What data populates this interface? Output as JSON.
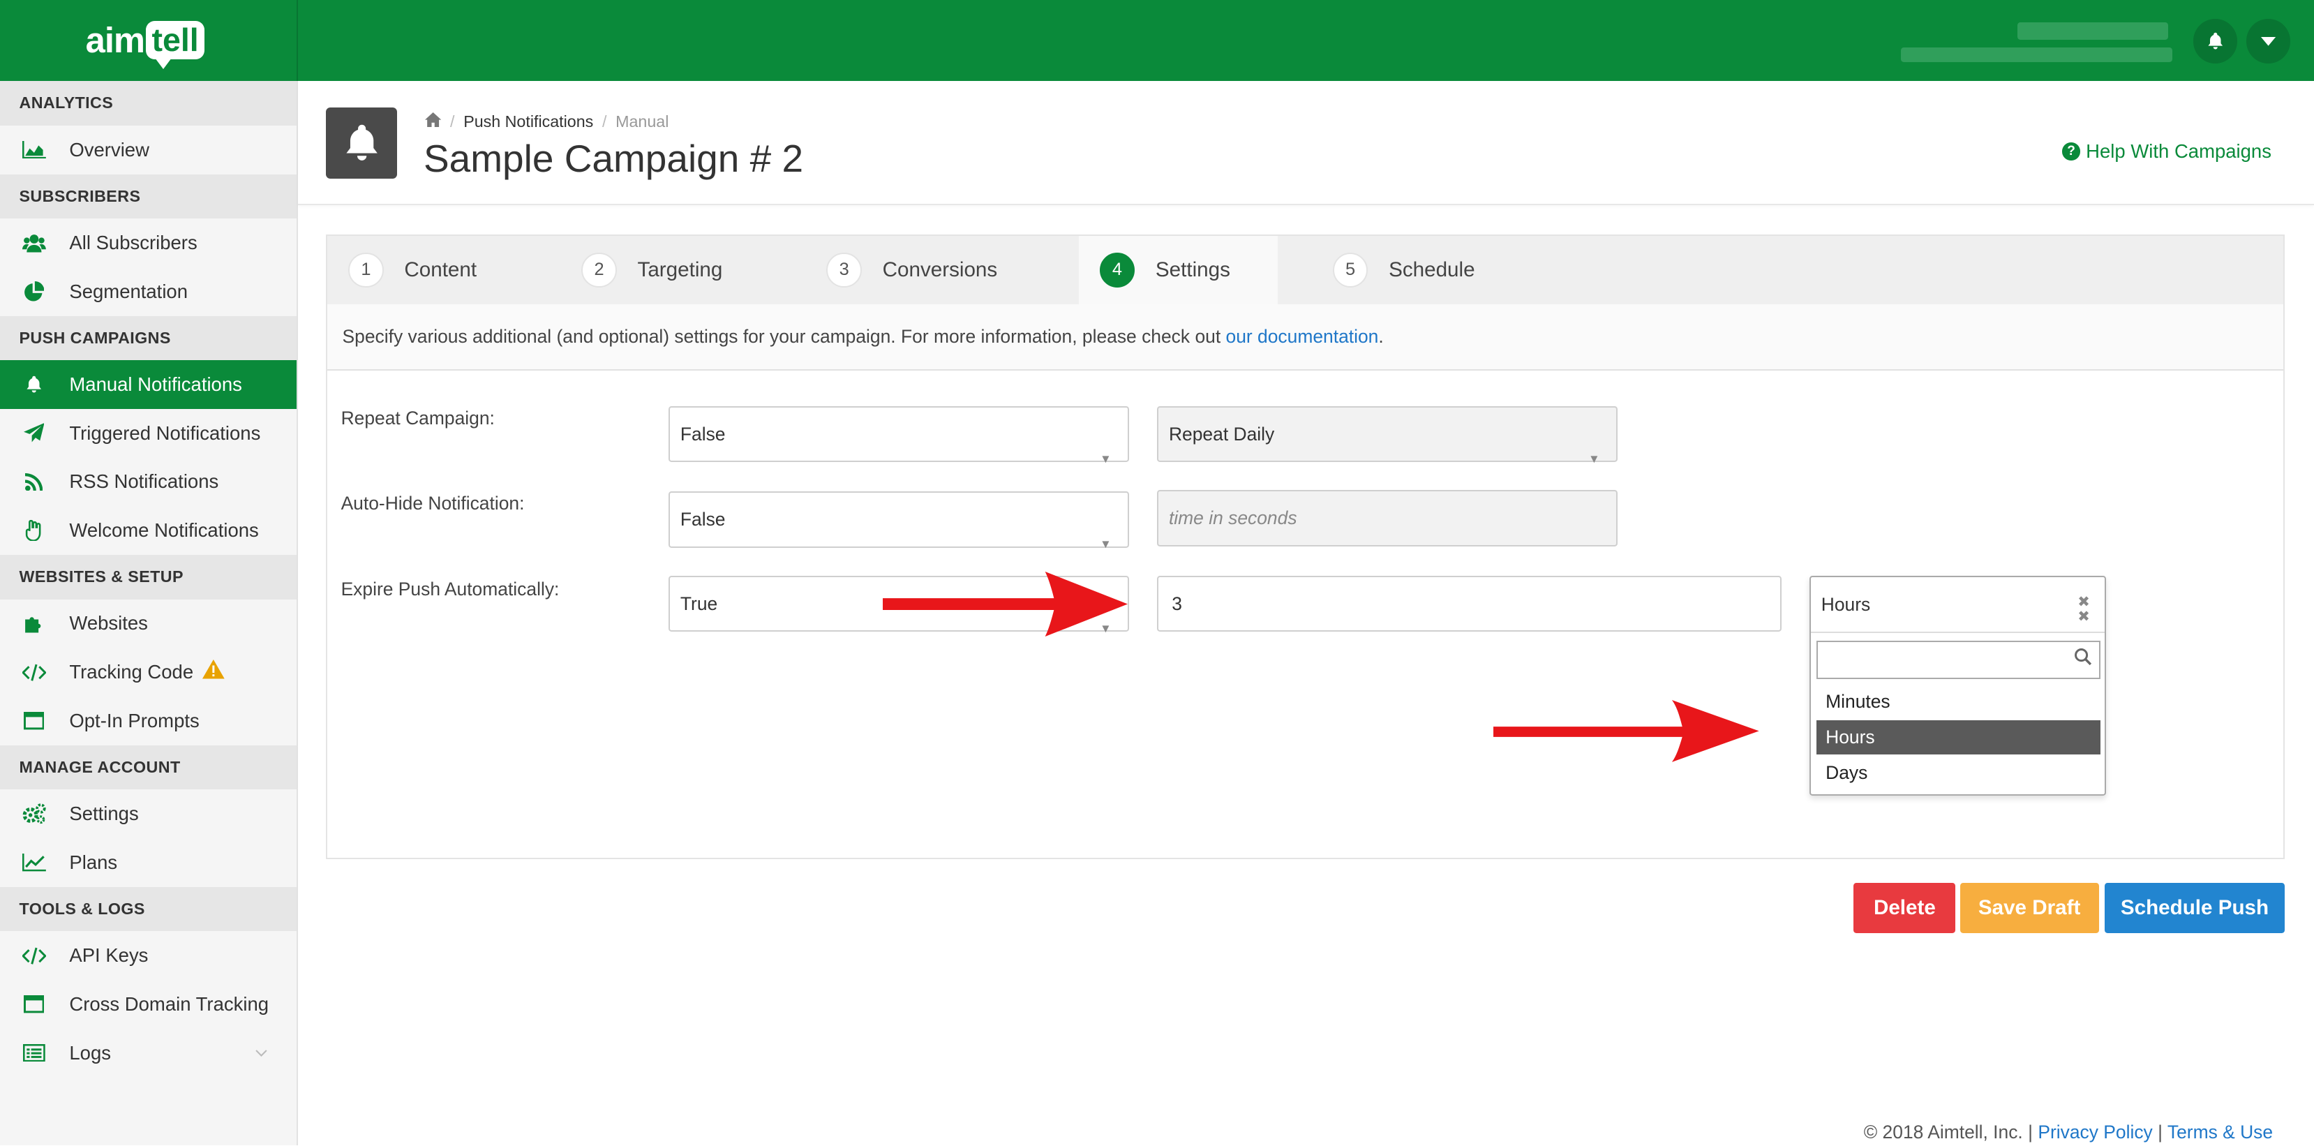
{
  "brand": {
    "logo_part1": "aim",
    "logo_part2": "tell"
  },
  "topbar": {
    "bell_icon": "bell-icon",
    "menu_icon": "chevron-down-icon"
  },
  "sidebar": {
    "sections": [
      {
        "title": "ANALYTICS",
        "items": [
          {
            "label": "Overview",
            "icon": "area-chart-icon"
          }
        ]
      },
      {
        "title": "SUBSCRIBERS",
        "items": [
          {
            "label": "All Subscribers",
            "icon": "users-icon"
          },
          {
            "label": "Segmentation",
            "icon": "pie-chart-icon"
          }
        ]
      },
      {
        "title": "PUSH CAMPAIGNS",
        "items": [
          {
            "label": "Manual Notifications",
            "icon": "bell-icon"
          },
          {
            "label": "Triggered Notifications",
            "icon": "paper-plane-icon"
          },
          {
            "label": "RSS Notifications",
            "icon": "rss-icon"
          },
          {
            "label": "Welcome Notifications",
            "icon": "hand-icon"
          }
        ]
      },
      {
        "title": "WEBSITES & SETUP",
        "items": [
          {
            "label": "Websites",
            "icon": "puzzle-icon"
          },
          {
            "label": "Tracking Code",
            "icon": "code-icon"
          },
          {
            "label": "Opt-In Prompts",
            "icon": "window-icon"
          }
        ]
      },
      {
        "title": "MANAGE ACCOUNT",
        "items": [
          {
            "label": "Settings",
            "icon": "gears-icon"
          },
          {
            "label": "Plans",
            "icon": "line-chart-icon"
          }
        ]
      },
      {
        "title": "TOOLS & LOGS",
        "items": [
          {
            "label": "API Keys",
            "icon": "code-icon"
          },
          {
            "label": "Cross Domain Tracking",
            "icon": "window-icon"
          },
          {
            "label": "Logs",
            "icon": "list-icon"
          }
        ]
      }
    ]
  },
  "header": {
    "breadcrumb": [
      "Push Notifications",
      "Manual"
    ],
    "title": "Sample Campaign # 2",
    "help": "Help With Campaigns"
  },
  "tabs": [
    {
      "num": "1",
      "label": "Content"
    },
    {
      "num": "2",
      "label": "Targeting"
    },
    {
      "num": "3",
      "label": "Conversions"
    },
    {
      "num": "4",
      "label": "Settings"
    },
    {
      "num": "5",
      "label": "Schedule"
    }
  ],
  "description": {
    "text": "Specify various additional (and optional) settings for your campaign. For more information, please check out ",
    "link": "our documentation",
    "end": "."
  },
  "settings": {
    "repeat": {
      "label": "Repeat Campaign:",
      "value": "False",
      "freq": "Repeat Daily"
    },
    "autohide": {
      "label": "Auto-Hide Notification:",
      "value": "False",
      "placeholder": "time in seconds"
    },
    "expire": {
      "label": "Expire Push Automatically:",
      "value": "True",
      "amount": "3",
      "unit": "Hours"
    }
  },
  "dropdown": {
    "options": [
      "Minutes",
      "Hours",
      "Days"
    ],
    "selected": "Hours"
  },
  "buttons": {
    "delete": "Delete",
    "save": "Save Draft",
    "schedule": "Schedule Push"
  },
  "footer": {
    "copyright": "© 2018 Aimtell, Inc. |",
    "privacy": "Privacy Policy",
    "sep": "|",
    "terms": "Terms & Use"
  },
  "colors": {
    "brand_green": "#0a8a3a",
    "delete": "#e83a3f",
    "draft": "#f7ae3f",
    "primary": "#2285d0",
    "arrow": "#e8161a"
  }
}
